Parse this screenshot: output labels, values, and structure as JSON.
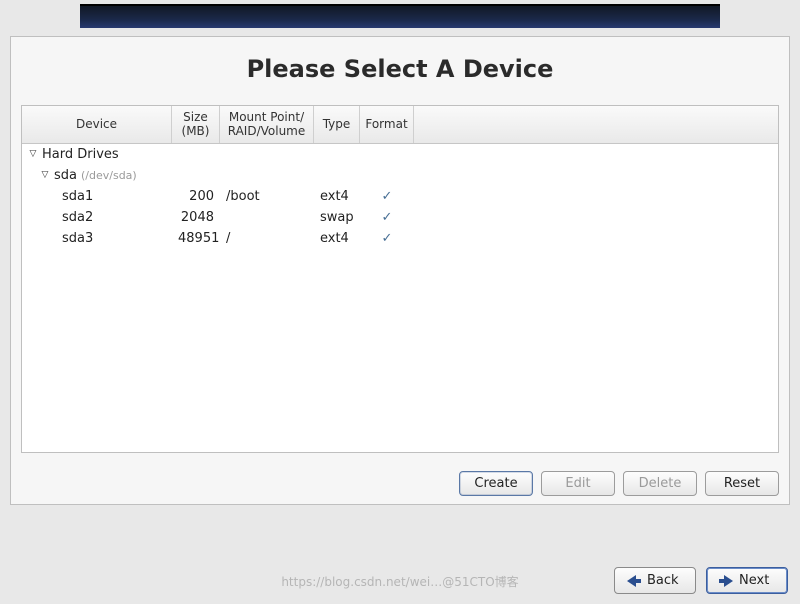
{
  "title": "Please Select A Device",
  "columns": {
    "device": "Device",
    "size": "Size\n(MB)",
    "mount": "Mount Point/\nRAID/Volume",
    "type": "Type",
    "format": "Format"
  },
  "tree": {
    "root_label": "Hard Drives",
    "disk_label": "sda",
    "disk_path": "(/dev/sda)"
  },
  "partitions": [
    {
      "name": "sda1",
      "size": "200",
      "mount": "/boot",
      "type": "ext4",
      "format": true
    },
    {
      "name": "sda2",
      "size": "2048",
      "mount": "",
      "type": "swap",
      "format": true
    },
    {
      "name": "sda3",
      "size": "48951",
      "mount": "/",
      "type": "ext4",
      "format": true
    }
  ],
  "buttons": {
    "create": "Create",
    "edit": "Edit",
    "delete": "Delete",
    "reset": "Reset"
  },
  "nav": {
    "back": "Back",
    "next": "Next"
  },
  "watermark": "https://blog.csdn.net/wei…@51CTO博客"
}
